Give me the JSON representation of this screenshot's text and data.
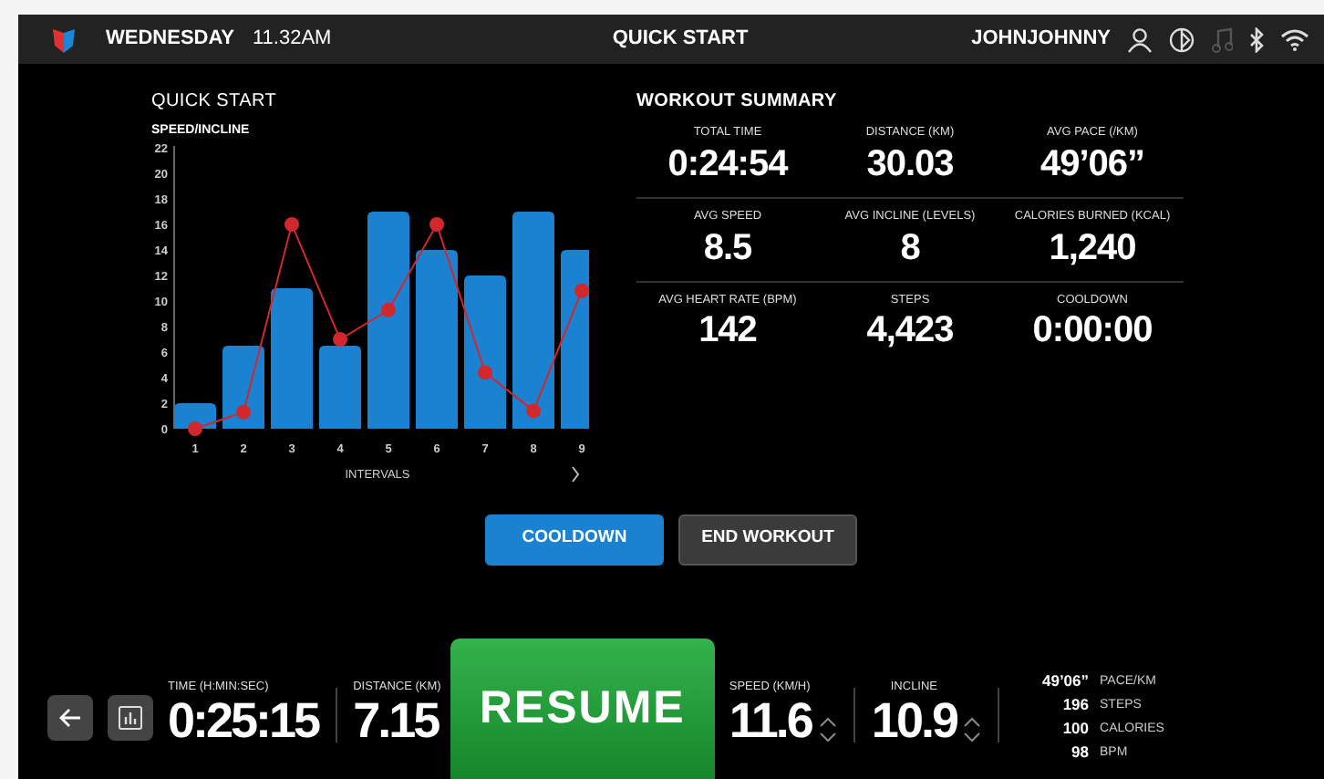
{
  "status_bar": {
    "day": "WEDNESDAY",
    "time": "11.32AM",
    "title": "QUICK START",
    "user": "JOHNJOHNNY"
  },
  "chart_panel": {
    "title": "QUICK START",
    "chart_data": {
      "type": "bar",
      "ylabel": "SPEED/INCLINE",
      "xlabel": "INTERVALS",
      "categories": [
        "1",
        "2",
        "3",
        "4",
        "5",
        "6",
        "7",
        "8",
        "9"
      ],
      "yticks": [
        0,
        2,
        4,
        6,
        8,
        10,
        12,
        14,
        16,
        18,
        20,
        22
      ],
      "ylim": [
        0,
        22
      ],
      "series": [
        {
          "type": "bar",
          "color": "#1a82d0",
          "values": [
            2,
            6.5,
            11,
            6.5,
            17,
            14,
            12,
            17,
            14
          ]
        },
        {
          "type": "line",
          "marker": "circle",
          "color": "#d0282c",
          "values": [
            0,
            1.3,
            16,
            7,
            9.3,
            16,
            4.4,
            1.4,
            10.8
          ]
        }
      ]
    }
  },
  "summary": {
    "title": "WORKOUT SUMMARY",
    "stats": [
      {
        "label": "TOTAL TIME",
        "value": "0:24:54"
      },
      {
        "label": "DISTANCE (KM)",
        "value": "30.03"
      },
      {
        "label": "AVG PACE (/KM)",
        "value": "49’06”"
      },
      {
        "label": "AVG SPEED",
        "value": "8.5"
      },
      {
        "label": "AVG INCLINE (LEVELS)",
        "value": "8"
      },
      {
        "label": "CALORIES BURNED (KCAL)",
        "value": "1,240"
      },
      {
        "label": "AVG HEART RATE (BPM)",
        "value": "142"
      },
      {
        "label": "STEPS",
        "value": "4,423"
      },
      {
        "label": "COOLDOWN",
        "value": "0:00:00"
      }
    ]
  },
  "actions": [
    {
      "label": "COOLDOWN",
      "kind": "primary"
    },
    {
      "label": "END WORKOUT",
      "kind": "secondary"
    }
  ],
  "console": {
    "time": {
      "label": "TIME (H:MIN:SEC)",
      "value": "0:25:15"
    },
    "distance": {
      "label": "DISTANCE (KM)",
      "value": "7.15"
    },
    "resume": "RESUME",
    "speed": {
      "label": "SPEED (KM/H)",
      "value": "11.6"
    },
    "incline": {
      "label": "INCLINE",
      "value": "10.9"
    },
    "side_stats": [
      {
        "value": "49’06”",
        "label": "PACE/KM"
      },
      {
        "value": "196",
        "label": "STEPS"
      },
      {
        "value": "100",
        "label": "CALORIES"
      },
      {
        "value": "98",
        "label": "BPM"
      }
    ]
  }
}
